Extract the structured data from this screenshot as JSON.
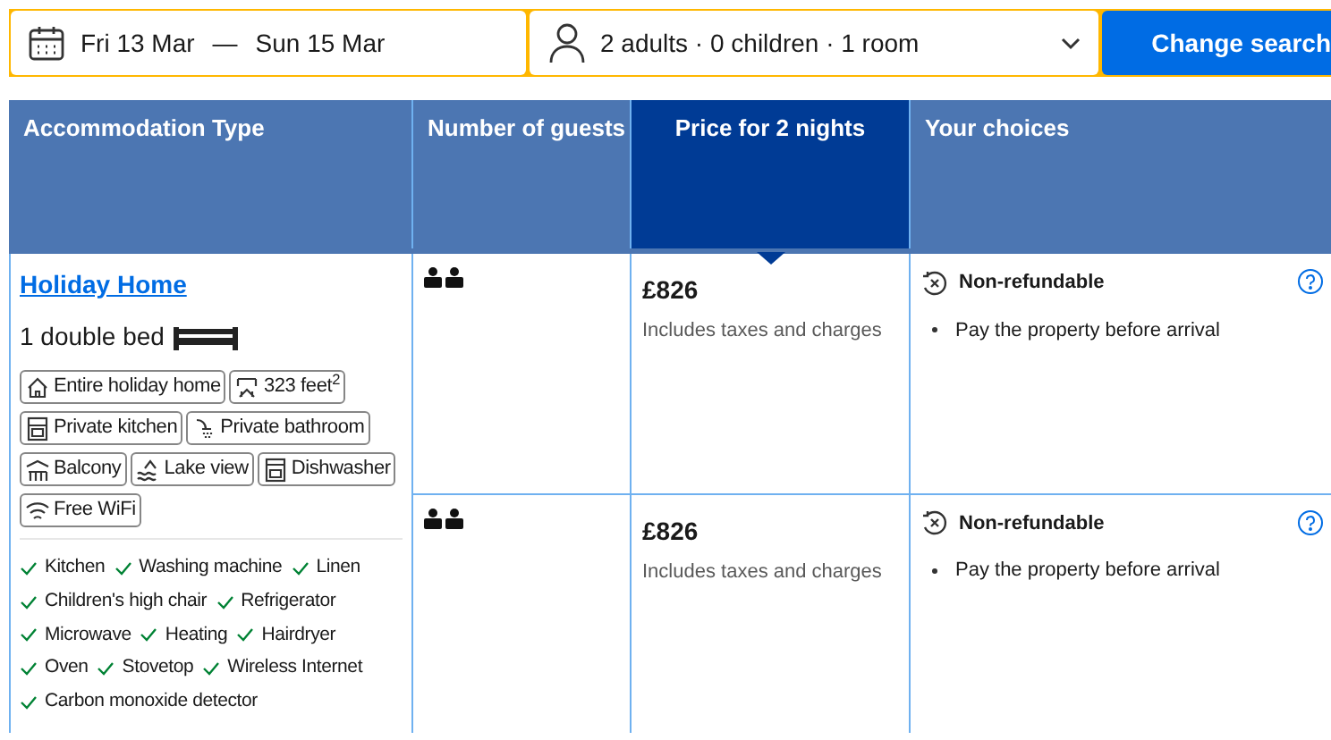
{
  "search_bar": {
    "check_in": "Fri 13 Mar",
    "separator": "—",
    "check_out": "Sun 15 Mar",
    "guests": "2 adults · 0 children · 1 room",
    "button": "Change search"
  },
  "table": {
    "columns": [
      {
        "label": "Accommodation Type",
        "selected": false
      },
      {
        "label": "Number of guests",
        "selected": false
      },
      {
        "label": "Price for 2 nights",
        "selected": true
      },
      {
        "label": "Your choices",
        "selected": false
      }
    ],
    "accommodation": {
      "name": "Holiday Home",
      "bed": "1 double bed",
      "features": [
        "Entire holiday home",
        "323 feet$^{2}$",
        "Private kitchen",
        "Private bathroom",
        "Balcony",
        "Lake view",
        "Dishwasher",
        "Free WiFi"
      ],
      "amenities": [
        "Kitchen",
        "Washing machine",
        "Linen",
        "Children's high chair",
        "Refrigerator",
        "Microwave",
        "Heating",
        "Hairdryer",
        "Oven",
        "Stovetop",
        "Wireless Internet",
        "Carbon monoxide detector"
      ]
    },
    "rows": [
      {
        "price": "£826",
        "price_note": "Includes taxes and charges",
        "policy": "Non-refundable",
        "conditions": [
          "Pay the property before arrival"
        ]
      },
      {
        "price": "£826",
        "price_note": "Includes taxes and charges",
        "policy": "Non-refundable",
        "conditions": [
          "Pay the property before arrival"
        ]
      }
    ]
  }
}
